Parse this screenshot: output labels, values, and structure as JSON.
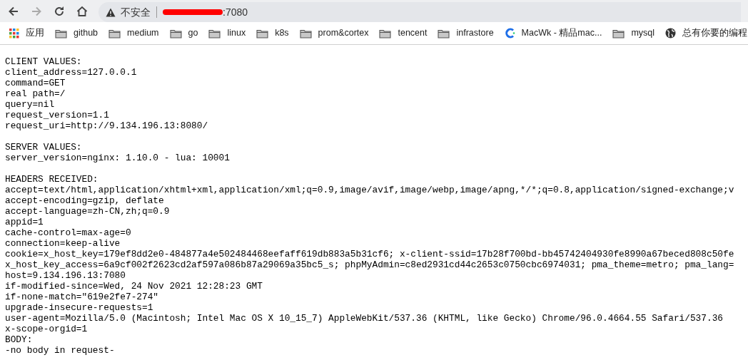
{
  "toolbar": {
    "security_label": "不安全",
    "url_suffix": ":7080",
    "forward_disabled": true
  },
  "bookmarks": [
    {
      "kind": "apps",
      "label": "应用"
    },
    {
      "kind": "folder",
      "label": "github"
    },
    {
      "kind": "folder",
      "label": "medium"
    },
    {
      "kind": "folder",
      "label": "go"
    },
    {
      "kind": "folder",
      "label": "linux"
    },
    {
      "kind": "folder",
      "label": "k8s"
    },
    {
      "kind": "folder",
      "label": "prom&cortex"
    },
    {
      "kind": "folder",
      "label": "tencent"
    },
    {
      "kind": "folder",
      "label": "infrastore"
    },
    {
      "kind": "site",
      "label": "MacWk - 精品mac..."
    },
    {
      "kind": "folder",
      "label": "mysql"
    },
    {
      "kind": "globe",
      "label": "总有你要的编程"
    }
  ],
  "paragraphs": [
    {
      "blocks": [
        {
          "heading": "CLIENT VALUES:",
          "lines": [
            "client_address=127.0.0.1",
            "command=GET",
            "real path=/",
            "query=nil",
            "request_version=1.1",
            "request_uri=http://9.134.196.13:8080/"
          ]
        }
      ]
    },
    {
      "blocks": [
        {
          "heading": "SERVER VALUES:",
          "lines": [
            "server_version=nginx: 1.10.0 - lua: 10001"
          ]
        }
      ]
    },
    {
      "blocks": [
        {
          "heading": "HEADERS RECEIVED:",
          "lines": [
            "accept=text/html,application/xhtml+xml,application/xml;q=0.9,image/avif,image/webp,image/apng,*/*;q=0.8,application/signed-exchange;v",
            "accept-encoding=gzip, deflate",
            "accept-language=zh-CN,zh;q=0.9",
            "appid=1",
            "cache-control=max-age=0",
            "connection=keep-alive",
            "cookie=x_host_key=179ef8dd2e0-484877a4e502484468eefaff619db883a5b31cf6; x-client-ssid=17b28f700bd-bb45742404930fe8990a67beced808c50fe",
            "x_host_key_access=6a9cf002f2623cd2af597a086b87a29069a35bc5_s; phpMyAdmin=c8ed2931cd44c2653c0750cbc6974031; pma_theme=metro; pma_lang=",
            "host=9.134.196.13:7080",
            "if-modified-since=Wed, 24 Nov 2021 12:28:23 GMT",
            "if-none-match=\"619e2fe7-274\"",
            "upgrade-insecure-requests=1",
            "user-agent=Mozilla/5.0 (Macintosh; Intel Mac OS X 10_15_7) AppleWebKit/537.36 (KHTML, like Gecko) Chrome/96.0.4664.55 Safari/537.36",
            "x-scope-orgid=1"
          ]
        },
        {
          "heading": "BODY:",
          "lines": [
            "-no body in request-"
          ]
        }
      ]
    }
  ]
}
